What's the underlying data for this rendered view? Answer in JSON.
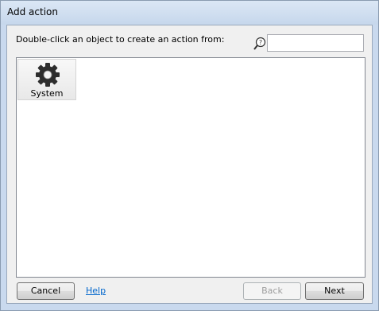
{
  "window": {
    "title": "Add action"
  },
  "dialog": {
    "prompt": "Double-click an object to create an action from:",
    "search": {
      "value": "",
      "placeholder": "",
      "icon": "search-help-icon"
    },
    "objects": [
      {
        "label": "System",
        "icon": "gear-icon"
      }
    ]
  },
  "footer": {
    "cancel_label": "Cancel",
    "help_label": "Help",
    "back_label": "Back",
    "next_label": "Next"
  },
  "colors": {
    "link": "#0066cc",
    "frame": "#c9d9ee",
    "client_bg": "#f0f0f0"
  }
}
